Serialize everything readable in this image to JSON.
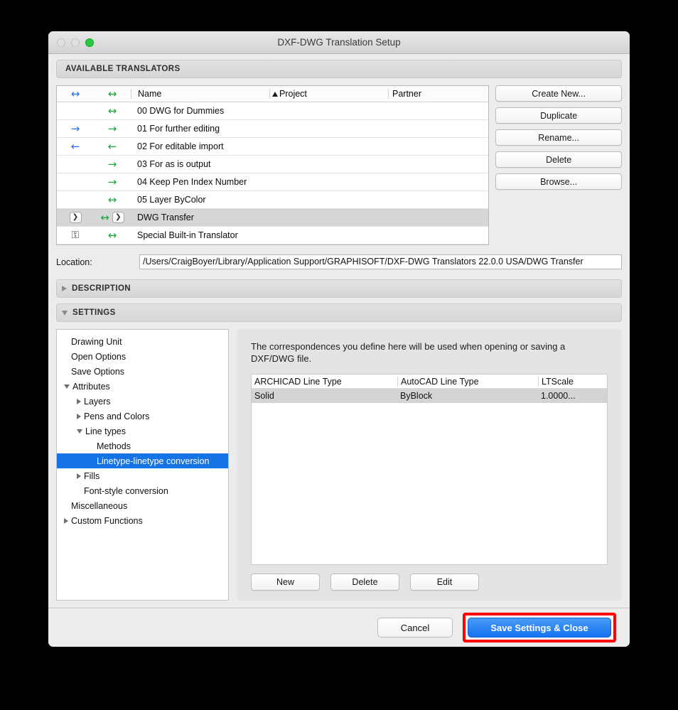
{
  "window": {
    "title": "DXF-DWG Translation Setup",
    "traffic_lights": [
      "close-disabled",
      "minimize-disabled",
      "zoom-green"
    ]
  },
  "available_translators": {
    "section_label": "AVAILABLE TRANSLATORS",
    "columns": {
      "open_icon": "↔",
      "save_icon": "↔",
      "name": "Name",
      "project": "Project",
      "project_sort": "▲",
      "partner": "Partner"
    },
    "rows": [
      {
        "open": "",
        "save": "↔",
        "name": "00 DWG for Dummies",
        "project": "",
        "partner": "",
        "selected": false,
        "locked": false,
        "chevrons": false
      },
      {
        "open": "→",
        "save": "→",
        "name": "01 For further editing",
        "project": "",
        "partner": "",
        "selected": false,
        "locked": false,
        "chevrons": false
      },
      {
        "open": "←",
        "save": "←",
        "name": "02 For editable import",
        "project": "",
        "partner": "",
        "selected": false,
        "locked": false,
        "chevrons": false
      },
      {
        "open": "",
        "save": "→",
        "name": "03 For as is output",
        "project": "",
        "partner": "",
        "selected": false,
        "locked": false,
        "chevrons": false
      },
      {
        "open": "",
        "save": "→",
        "name": "04 Keep Pen Index Number",
        "project": "",
        "partner": "",
        "selected": false,
        "locked": false,
        "chevrons": false
      },
      {
        "open": "",
        "save": "↔",
        "name": "05 Layer ByColor",
        "project": "",
        "partner": "",
        "selected": false,
        "locked": false,
        "chevrons": false
      },
      {
        "open": "",
        "save": "↔",
        "name": "DWG Transfer",
        "project": "",
        "partner": "",
        "selected": true,
        "locked": false,
        "chevrons": true
      },
      {
        "open": "lock",
        "save": "↔",
        "name": "Special Built-in Translator",
        "project": "",
        "partner": "",
        "selected": false,
        "locked": true,
        "chevrons": false
      }
    ],
    "side_buttons": [
      {
        "label": "Create New..."
      },
      {
        "label": "Duplicate"
      },
      {
        "label": "Rename..."
      },
      {
        "label": "Delete"
      },
      {
        "label": "Browse..."
      }
    ]
  },
  "location": {
    "label": "Location:",
    "value": "/Users/CraigBoyer/Library/Application Support/GRAPHISOFT/DXF-DWG Translators 22.0.0 USA/DWG Transfer"
  },
  "sections": {
    "description": {
      "label": "DESCRIPTION",
      "expanded": false
    },
    "settings": {
      "label": "SETTINGS",
      "expanded": true
    }
  },
  "settings_tree": [
    {
      "label": "Drawing Unit",
      "indent": 0,
      "twisty": "none",
      "selected": false
    },
    {
      "label": "Open Options",
      "indent": 0,
      "twisty": "none",
      "selected": false
    },
    {
      "label": "Save Options",
      "indent": 0,
      "twisty": "none",
      "selected": false
    },
    {
      "label": "Attributes",
      "indent": 0,
      "twisty": "down",
      "selected": false
    },
    {
      "label": "Layers",
      "indent": 1,
      "twisty": "right",
      "selected": false
    },
    {
      "label": "Pens and Colors",
      "indent": 1,
      "twisty": "right",
      "selected": false
    },
    {
      "label": "Line types",
      "indent": 1,
      "twisty": "down",
      "selected": false
    },
    {
      "label": "Methods",
      "indent": 2,
      "twisty": "none",
      "selected": false
    },
    {
      "label": "Linetype-linetype conversion",
      "indent": 2,
      "twisty": "none",
      "selected": true
    },
    {
      "label": "Fills",
      "indent": 1,
      "twisty": "right",
      "selected": false
    },
    {
      "label": "Font-style conversion",
      "indent": 1,
      "twisty": "none",
      "selected": false
    },
    {
      "label": "Miscellaneous",
      "indent": 0,
      "twisty": "none",
      "selected": false
    },
    {
      "label": "Custom Functions",
      "indent": 0,
      "twisty": "right",
      "selected": false
    }
  ],
  "panel": {
    "description": "The correspondences you define here will be used when opening or saving a DXF/DWG file.",
    "table": {
      "headers": [
        "ARCHICAD Line Type",
        "AutoCAD Line Type",
        "LTScale"
      ],
      "rows": [
        {
          "archicad": "Solid",
          "autocad": "ByBlock",
          "ltscale": "1.0000...",
          "selected": true
        }
      ]
    },
    "buttons": [
      {
        "label": "New"
      },
      {
        "label": "Delete"
      },
      {
        "label": "Edit"
      }
    ]
  },
  "footer": {
    "cancel_label": "Cancel",
    "save_label": "Save Settings & Close",
    "highlight_color": "#ff0000"
  }
}
